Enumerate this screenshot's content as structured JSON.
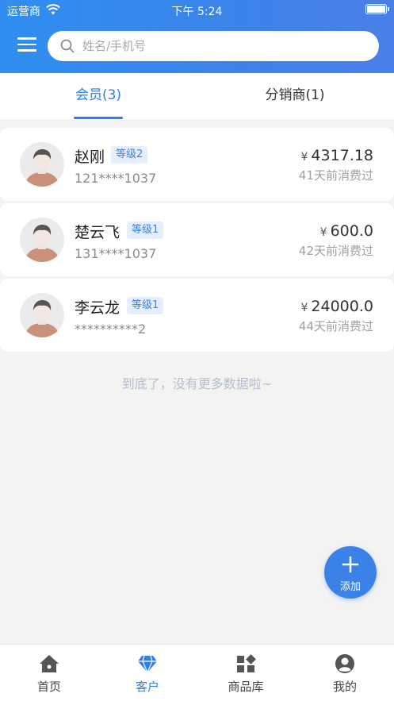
{
  "status_bar": {
    "carrier": "运营商",
    "time": "下午 5:24"
  },
  "header": {
    "search_placeholder": "姓名/手机号"
  },
  "tabs": [
    {
      "label": "会员(3)",
      "active": true
    },
    {
      "label": "分销商(1)",
      "active": false
    }
  ],
  "members": [
    {
      "name": "赵刚",
      "level": "等级2",
      "phone": "121****1037",
      "currency": "¥",
      "amount": "4317.18",
      "last_purchase": "41天前消费过"
    },
    {
      "name": "楚云飞",
      "level": "等级1",
      "phone": "131****1037",
      "currency": "¥",
      "amount": "600.0",
      "last_purchase": "42天前消费过"
    },
    {
      "name": "李云龙",
      "level": "等级1",
      "phone": "**********2",
      "currency": "¥",
      "amount": "24000.0",
      "last_purchase": "44天前消费过"
    }
  ],
  "end_text": "到底了，没有更多数据啦~",
  "fab": {
    "label": "添加"
  },
  "tabbar": [
    {
      "label": "首页",
      "icon": "home-icon",
      "active": false
    },
    {
      "label": "客户",
      "icon": "diamond-icon",
      "active": true
    },
    {
      "label": "商品库",
      "icon": "grid-icon",
      "active": false
    },
    {
      "label": "我的",
      "icon": "user-icon",
      "active": false
    }
  ],
  "colors": {
    "accent": "#2f7de9",
    "header_gradient_start": "#2f8ef0",
    "header_gradient_end": "#4a7fe8",
    "badge_bg": "#e6effd",
    "badge_text": "#3d7fe6",
    "page_bg": "#f3f3f4"
  }
}
